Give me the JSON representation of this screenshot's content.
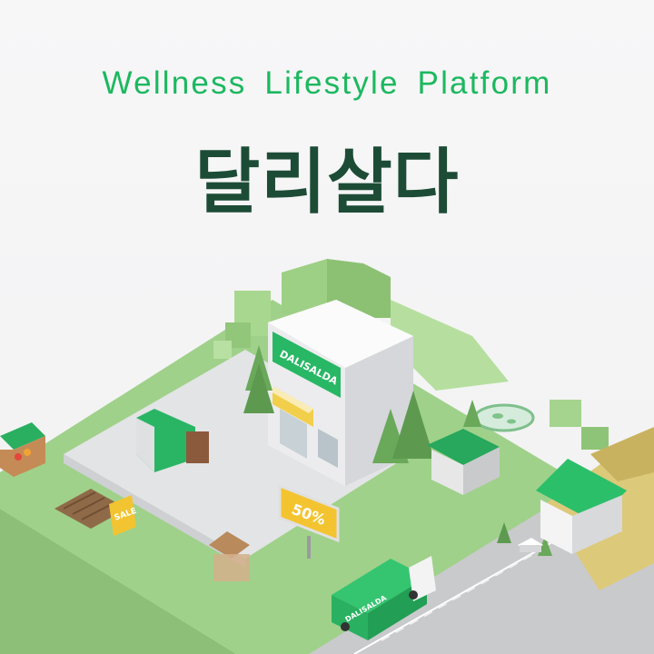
{
  "header": {
    "tagline": "Wellness Lifestyle Platform",
    "title": "달리살다"
  },
  "scene": {
    "store_sign": "DALISALDA",
    "truck_label": "DALISALDA",
    "billboard_text": "50%",
    "sale_sign": "SALE"
  },
  "colors": {
    "accent_green": "#1cb85f",
    "title_dark_green": "#1d4c36",
    "grass": "#a6d58a",
    "road": "#c9cacc"
  }
}
